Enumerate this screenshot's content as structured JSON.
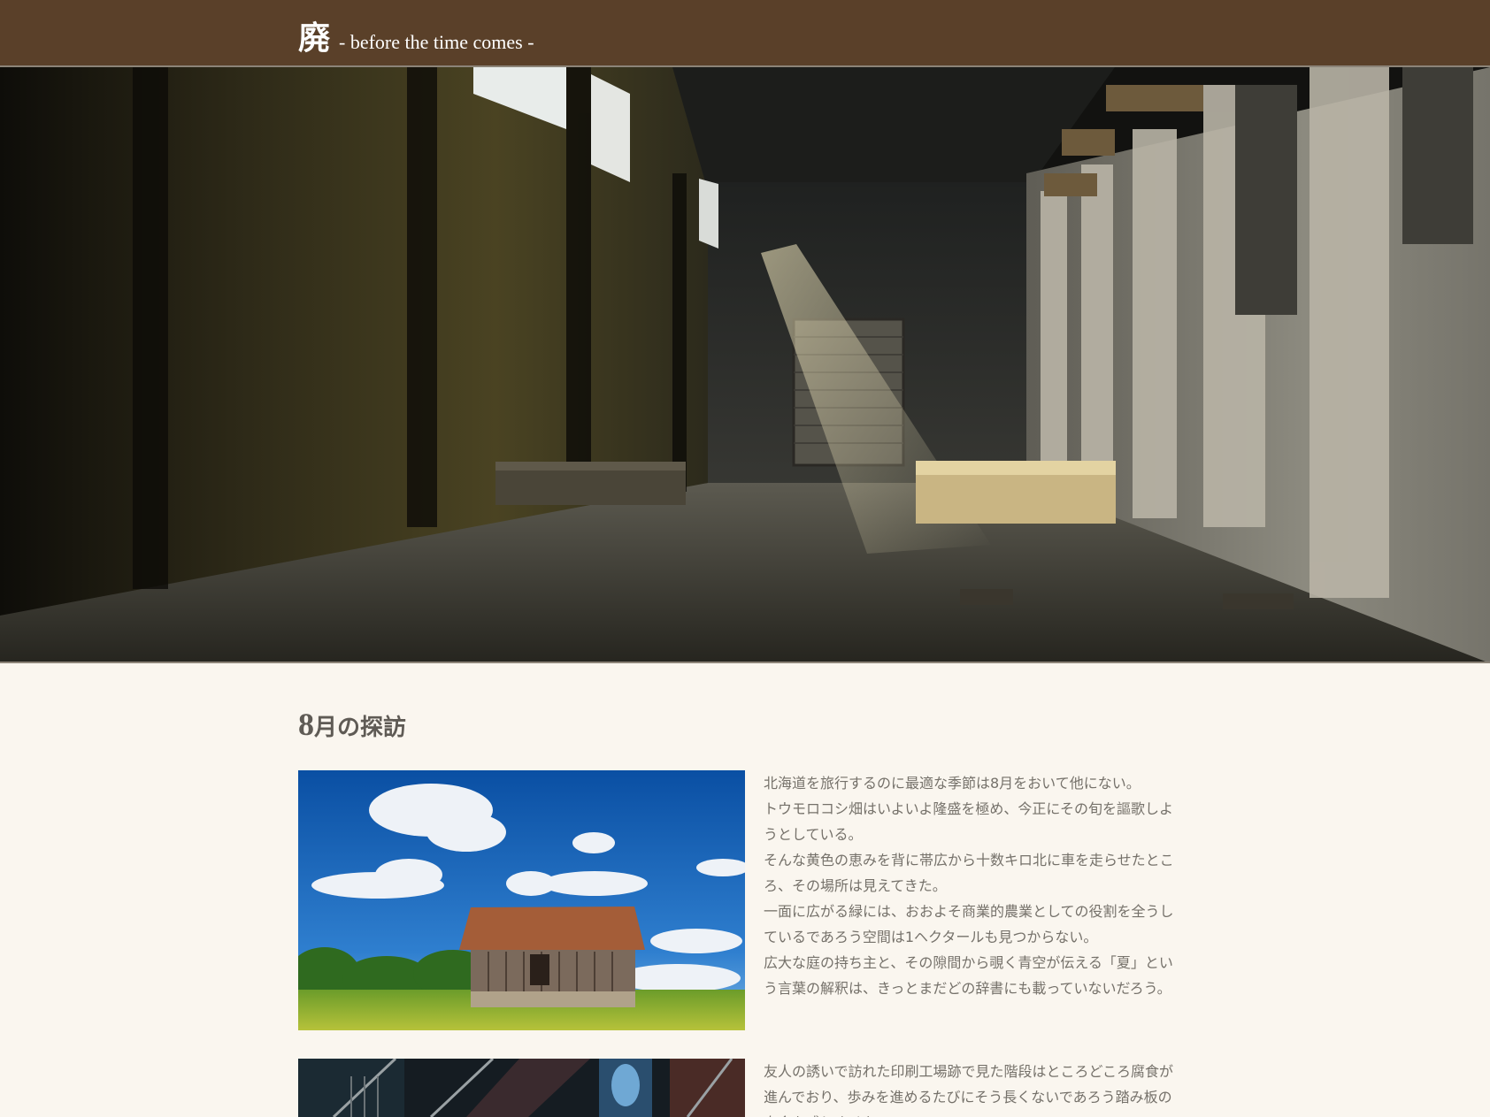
{
  "header": {
    "title_kanji": "廃",
    "tagline": "- before the time comes -"
  },
  "hero": {
    "icon": "abandoned-factory-hall-photo"
  },
  "section": {
    "title_num": "8",
    "title_rest": "月の探訪"
  },
  "articles": [
    {
      "image": "abandoned-barn-photo",
      "paragraphs": [
        "北海道を旅行するのに最適な季節は8月をおいて他にない。",
        "トウモロコシ畑はいよいよ隆盛を極め、今正にその旬を謳歌しようとしている。",
        "そんな黄色の恵みを背に帯広から十数キロ北に車を走らせたところ、その場所は見えてきた。",
        "一面に広がる緑には、おおよそ商業的農業としての役割を全うしているであろう空間は1ヘクタールも見つからない。",
        "広大な庭の持ち主と、その隙間から覗く青空が伝える「夏」という言葉の解釈は、きっとまだどの辞書にも載っていないだろう。"
      ]
    },
    {
      "image": "printing-factory-stairs-photo",
      "paragraphs": [
        "友人の誘いで訪れた印刷工場跡で見た階段はところどころ腐食が進んでおり、歩みを進めるたびにそう長くないであろう踏み板の寿命を感じさせた。"
      ]
    }
  ]
}
